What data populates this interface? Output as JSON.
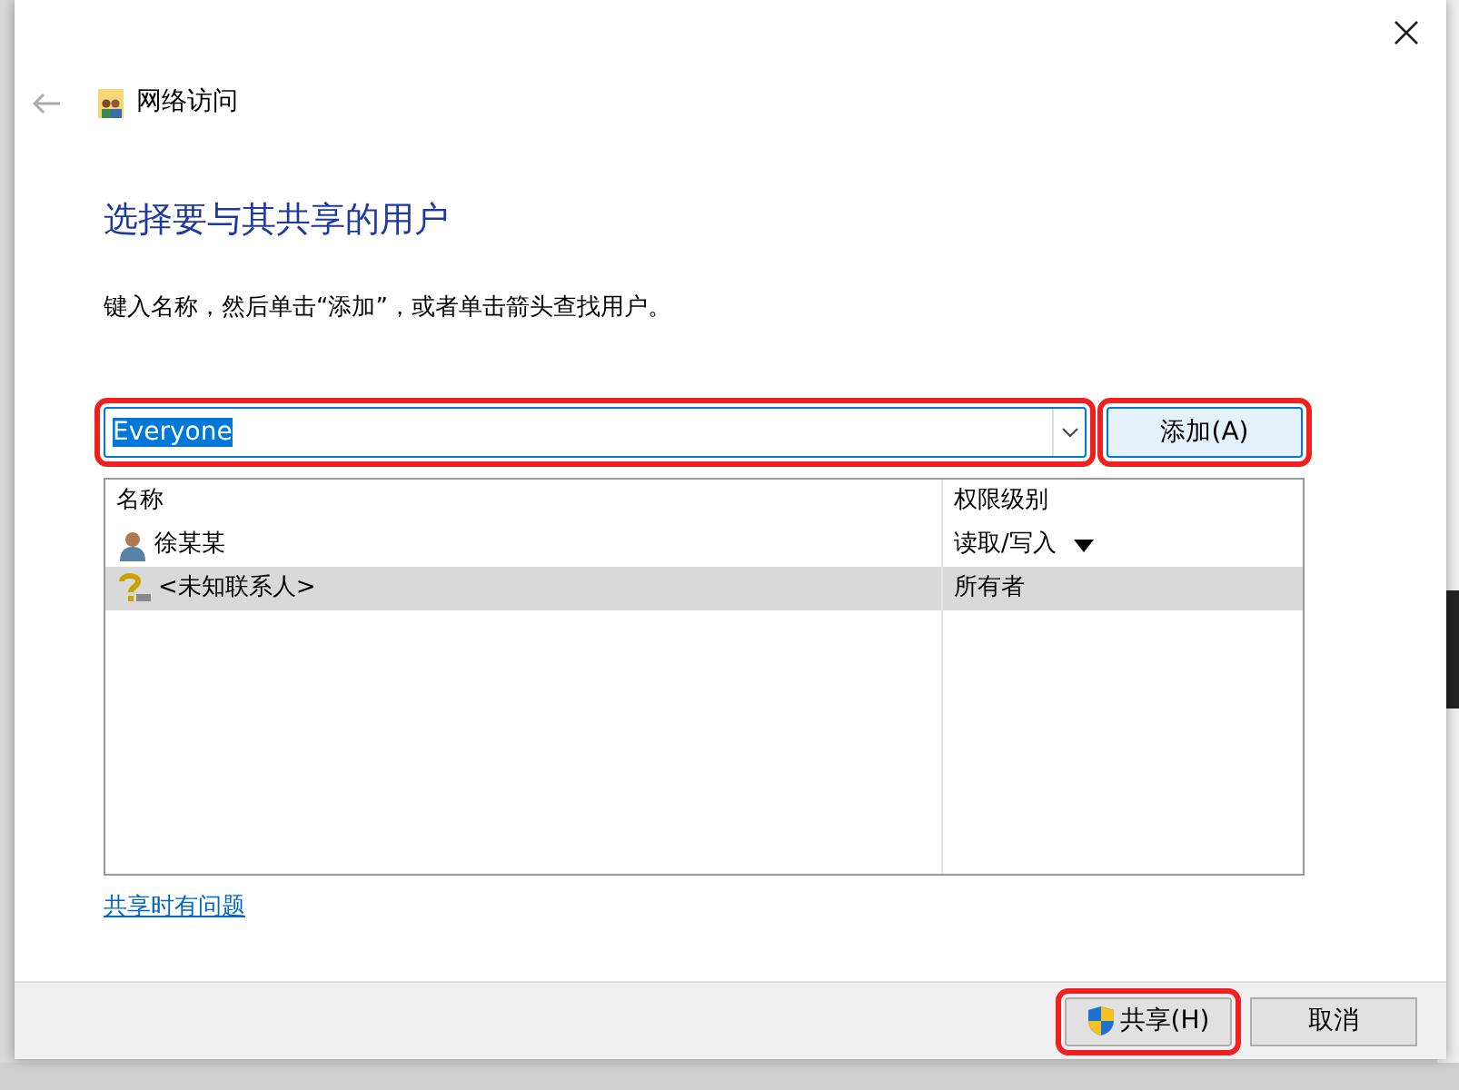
{
  "window": {
    "title": "网络访问"
  },
  "heading": "选择要与其共享的用户",
  "instruction": "键入名称，然后单击“添加”，或者单击箭头查找用户。",
  "name_field": {
    "value": "Everyone",
    "text_selected": true,
    "highlighted": true
  },
  "add_button": {
    "label": "添加(A)",
    "highlighted": true
  },
  "table": {
    "columns": [
      "名称",
      "权限级别"
    ],
    "rows": [
      {
        "kind": "user",
        "name": "徐某某",
        "permission": "读取/写入",
        "menu": true,
        "selected": false
      },
      {
        "kind": "unknown",
        "name": "<未知联系人>",
        "permission": "所有者",
        "menu": false,
        "selected": true
      }
    ]
  },
  "help_link": "共享时有问题",
  "buttons": [
    {
      "kind": "shield",
      "label": "共享(H)",
      "highlighted": true
    },
    {
      "kind": "plain",
      "label": "取消",
      "highlighted": false
    }
  ]
}
